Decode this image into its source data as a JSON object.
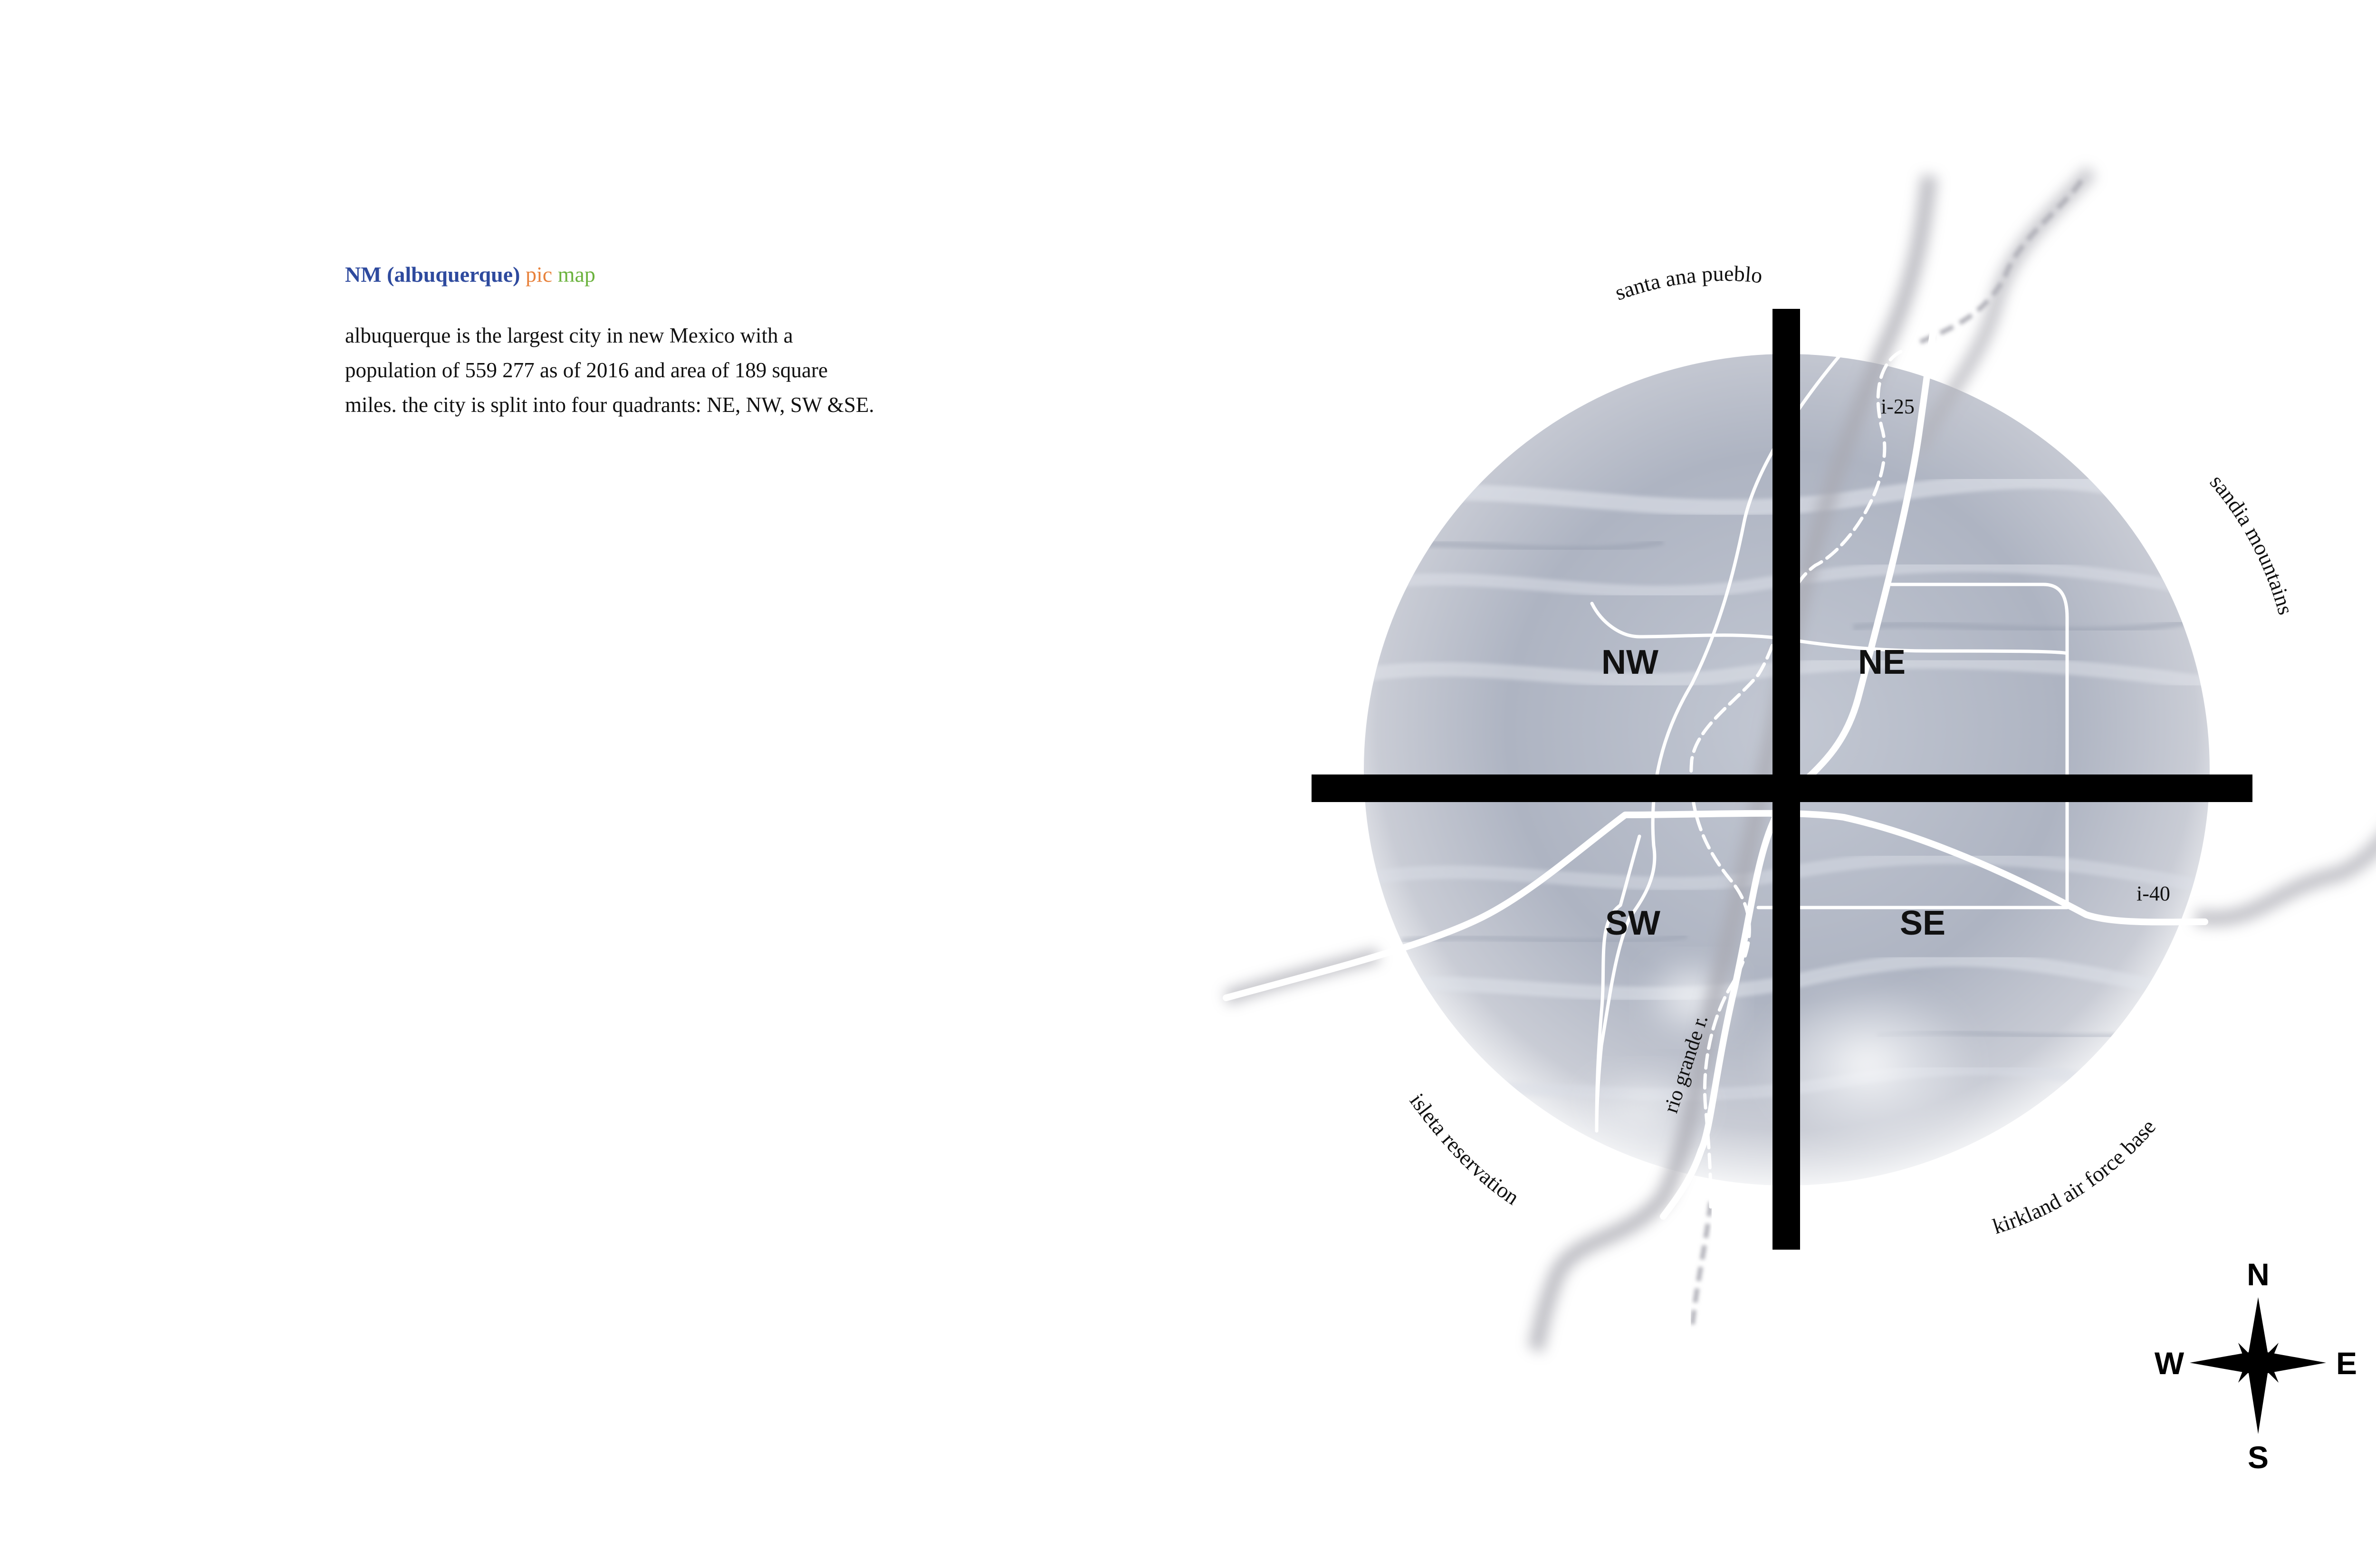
{
  "header": {
    "title_main": "NM (albuquerque)",
    "title_pic": "pic",
    "title_map": "map",
    "colors": {
      "title_main": "#2e4a9e",
      "title_pic": "#e8823c",
      "title_map": "#6cb33f"
    }
  },
  "description": "albuquerque is the largest city in new Mexico with a population of 559 277 as of 2016 and area of 189 square miles.  the city is split into four quadrants: NE, NW, SW &SE.",
  "map": {
    "quadrants": {
      "nw": "NW",
      "ne": "NE",
      "sw": "SW",
      "se": "SE"
    },
    "roads": {
      "interstate_25": "i-25",
      "interstate_40": "i-40"
    },
    "river": "rio grande r.",
    "places": {
      "north": "santa ana pueblo",
      "east": "sandia mountains",
      "southwest": "isleta reservation",
      "southeast": "kirkland air force base"
    },
    "colors": {
      "axes": "#000000",
      "roads": "#ffffff",
      "disc": "#b9bfcb"
    }
  },
  "compass": {
    "n": "N",
    "s": "S",
    "e": "E",
    "w": "W"
  }
}
